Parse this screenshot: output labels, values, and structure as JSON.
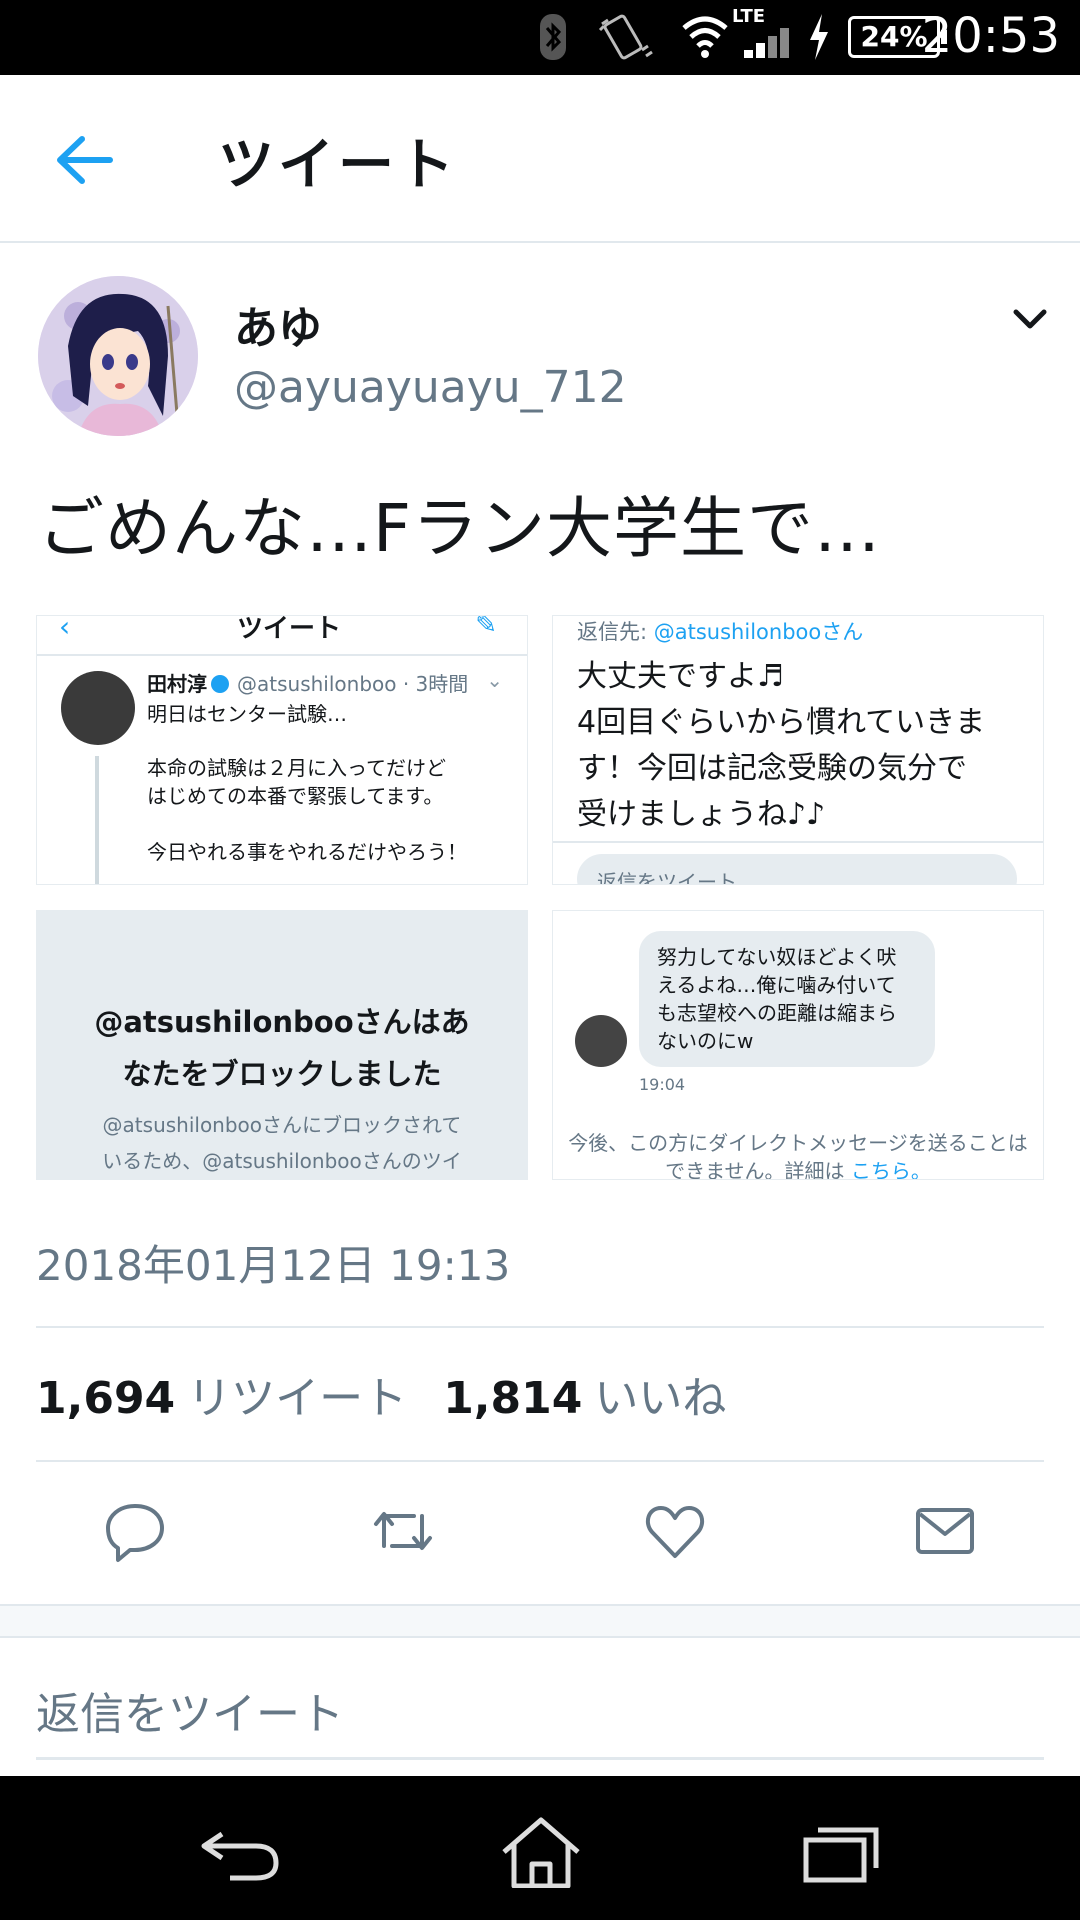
{
  "status_bar": {
    "network": "LTE",
    "battery": "24%",
    "time": "20:53",
    "icons": [
      "bluetooth-icon",
      "vibrate-icon",
      "wifi-icon",
      "signal-icon",
      "charging-icon"
    ]
  },
  "header": {
    "title": "ツイート",
    "back_icon": "back-arrow-icon"
  },
  "tweet": {
    "display_name": "あゆ",
    "handle": "@ayuayuayu_712",
    "text": "ごめんな…Fラン大学生で…",
    "date": "2018年01月12日 19:13",
    "retweet_count": "1,694",
    "retweet_label": "リツイート",
    "like_count": "1,814",
    "like_label": "いいね"
  },
  "media": {
    "m1": {
      "header_title": "ツイート",
      "name": "田村淳",
      "meta": "@atsushilonboo · 3時間",
      "lines": [
        "明日はセンター試験…",
        "本命の試験は２月に入ってだけど",
        "はじめての本番で緊張してます。",
        "今日やれる事をやれるだけやろう！"
      ]
    },
    "m2": {
      "reply_prefix": "返信先:",
      "reply_account": "@atsushilonbooさん",
      "body_lines": [
        "大丈夫ですよ♬",
        "4回目ぐらいから慣れていきま",
        "す！今回は記念受験の気分で",
        "受けましょうね♪♪"
      ],
      "reply_placeholder": "返信をツイート"
    },
    "m3": {
      "title_lines": [
        "@atsushilonbooさんはあ",
        "なたをブロックしました"
      ],
      "sub_lines": [
        "@atsushilonbooさんにブロックされて",
        "いるため、@atsushilonbooさんのツイ"
      ]
    },
    "m4": {
      "bubble_lines": [
        "努力してない奴ほどよく吠",
        "えるよね…俺に噛み付いて",
        "も志望校への距離は縮まら",
        "ないのにw"
      ],
      "time": "19:04",
      "notice_line1": "今後、この方にダイレクトメッセージを送ることは",
      "notice_line2": "できません。詳細は",
      "notice_link": "こちら。"
    }
  },
  "actions": [
    "reply-icon",
    "retweet-icon",
    "like-icon",
    "direct-message-icon"
  ],
  "reply_box": {
    "placeholder": "返信をツイート"
  },
  "nav_bar": [
    "nav-back-icon",
    "nav-home-icon",
    "nav-recents-icon"
  ],
  "colors": {
    "accent": "#1da1f2",
    "secondary_text": "#657786",
    "divider": "#e1e8ed"
  }
}
